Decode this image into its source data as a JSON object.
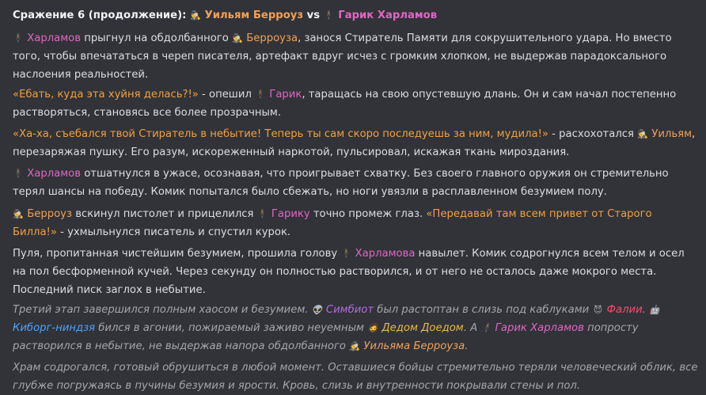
{
  "header": {
    "prefix": "Сражение 6 (продолжение): ",
    "fighter1": "Уильям Берроуз",
    "vs": " vs ",
    "fighter2": "Гарик Харламов"
  },
  "p1": {
    "name1": "Харламов",
    "t1": " прыгнул на обдолбанного ",
    "name2": "Берроуза",
    "t2": ", занося Стиратель Памяти для сокрушительного удара. Но вместо того, чтобы впечататься в череп писателя, артефакт вдруг исчез с громким хлопком, не выдержав парадоксального наслоения реальностей."
  },
  "p2": {
    "quote": "«Ебать, куда эта хуйня делась?!»",
    "t1": " - опешил ",
    "name": "Гарик",
    "t2": ", таращась на свою опустевшую длань. Он и сам начал постепенно растворяться, становясь все более прозрачным."
  },
  "p3": {
    "quote": "«Ха-ха, съебался твой Стиратель в небытие! Теперь ты сам скоро последуешь за ним, мудила!»",
    "t1": " - расхохотался ",
    "name": "Уильям",
    "t2": ", перезаряжая пушку. Его разум, искореженный наркотой, пульсировал, искажая ткань мироздания."
  },
  "p4": {
    "name": "Харламов",
    "t1": " отшатнулся в ужасе, осознавая, что проигрывает схватку. Без своего главного оружия он стремительно терял шансы на победу. Комик попытался было сбежать, но ноги увязли в расплавленном безумием полу."
  },
  "p5": {
    "name1": "Берроуз",
    "t1": " вскинул пистолет и прицелился ",
    "name2": "Гарику",
    "t2": " точно промеж глаз. ",
    "quote": "«Передавай там всем привет от Старого Билла!»",
    "t3": " - ухмыльнулся писатель и спустил курок."
  },
  "p6": {
    "t1": "Пуля, пропитанная чистейшим безумием, прошила голову ",
    "name": "Харламова",
    "t2": " навылет. Комик содрогнулся всем телом и осел на пол бесформенной кучей. Через секунду он полностью растворился, и от него не осталось даже мокрого места. Последний писк заглох в небытие."
  },
  "p7": {
    "t1": "Третий этап завершился полным хаосом и безумием. ",
    "name1": "Симбиот",
    "t2": " был растоптан в слизь под каблуками ",
    "name2": "Фалии",
    "t3": ". ",
    "name3": "Киборг-ниндзя",
    "t4": " бился в агонии, пожираемый заживо неуемным ",
    "name4": "Дедом Доедом",
    "t5": ". А ",
    "name5": "Гарик Харламов",
    "t6": " попросту растворился в небытие, не выдержав напора обдолбанного ",
    "name6": "Уильяма Берроуза",
    "t7": "."
  },
  "p8": {
    "text": "Храм содрогался, готовый обрушиться в любой момент. Оставшиеся бойцы стремительно теряли человеческий облик, все глубже погружаясь в пучины безумия и ярости. Кровь, слизь и внутренности покрывали стены и пол."
  },
  "icons": {
    "burroughs": "🕵",
    "harlamov": "🕴",
    "symbiote": "👽",
    "falia": "😈",
    "cyborg": "🤖",
    "ded": "🧔"
  },
  "colors": {
    "background": "#313338",
    "text": "#dbdee1",
    "orange_name": "#f0a05a",
    "pink_name": "#e066c4",
    "quote": "#f0a040",
    "italic": "#a3a6ad"
  }
}
